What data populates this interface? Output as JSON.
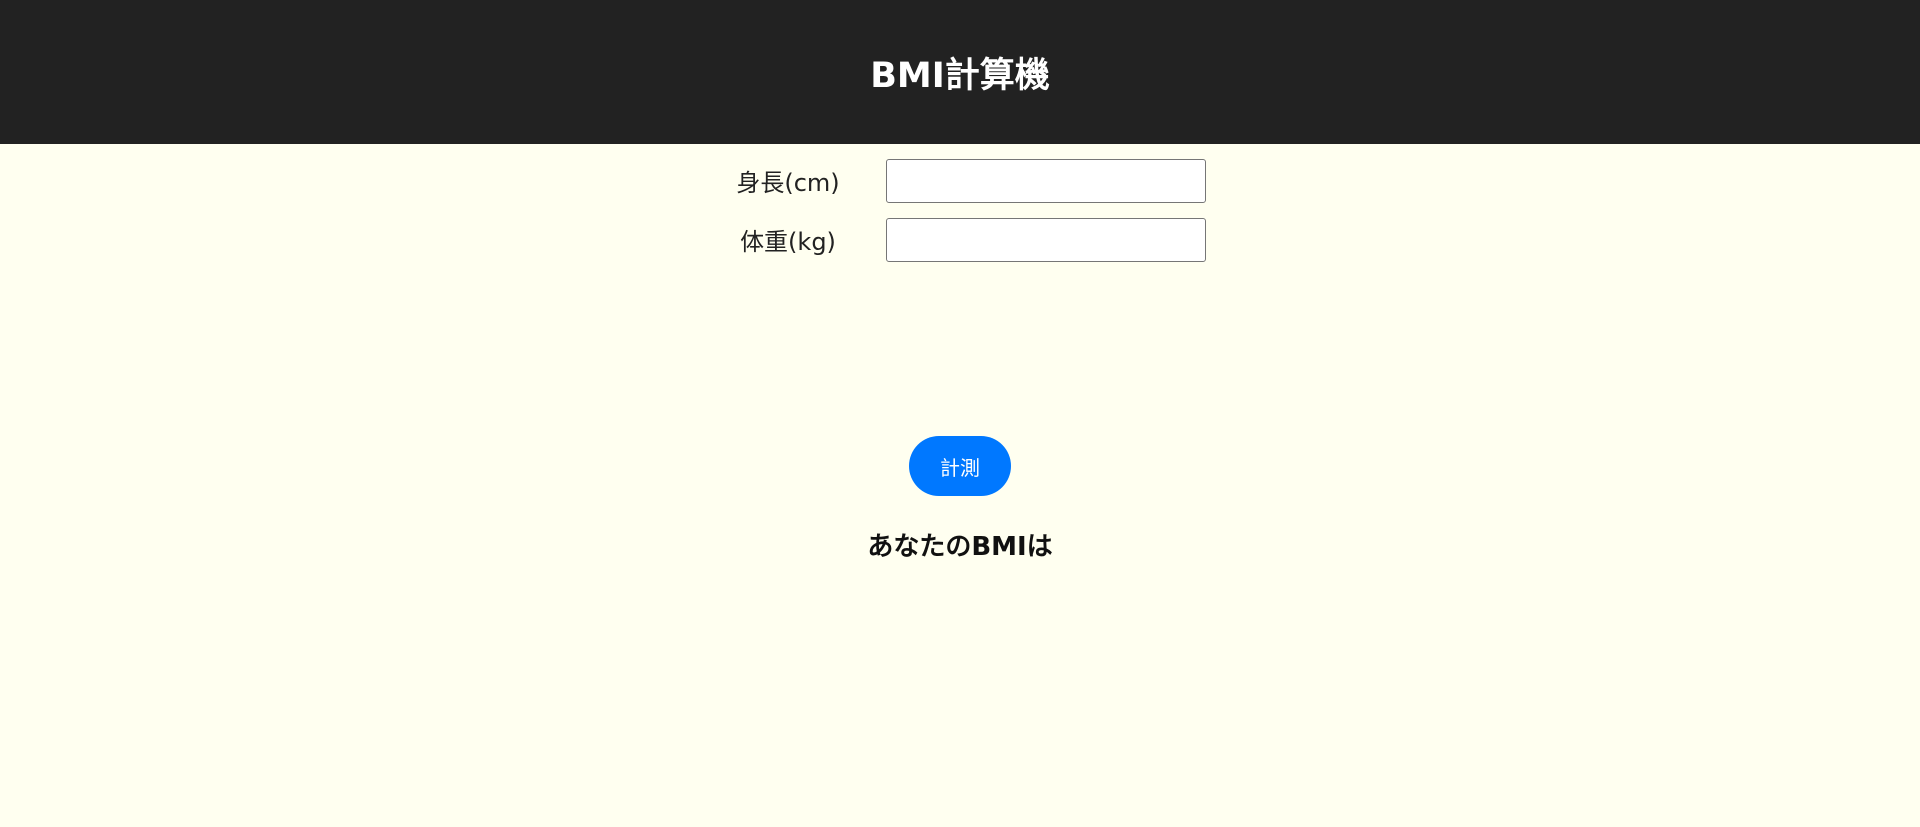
{
  "header": {
    "title": "BMI計算機",
    "background_color": "#222222"
  },
  "form": {
    "height_label": "身長(cm)",
    "height_value": "",
    "weight_label": "体重(kg)",
    "weight_value": ""
  },
  "actions": {
    "measure_label": "計測",
    "accent_color": "#0078ff"
  },
  "result": {
    "heading": "あなたのBMIは"
  },
  "page": {
    "background_color": "#fffff0"
  }
}
